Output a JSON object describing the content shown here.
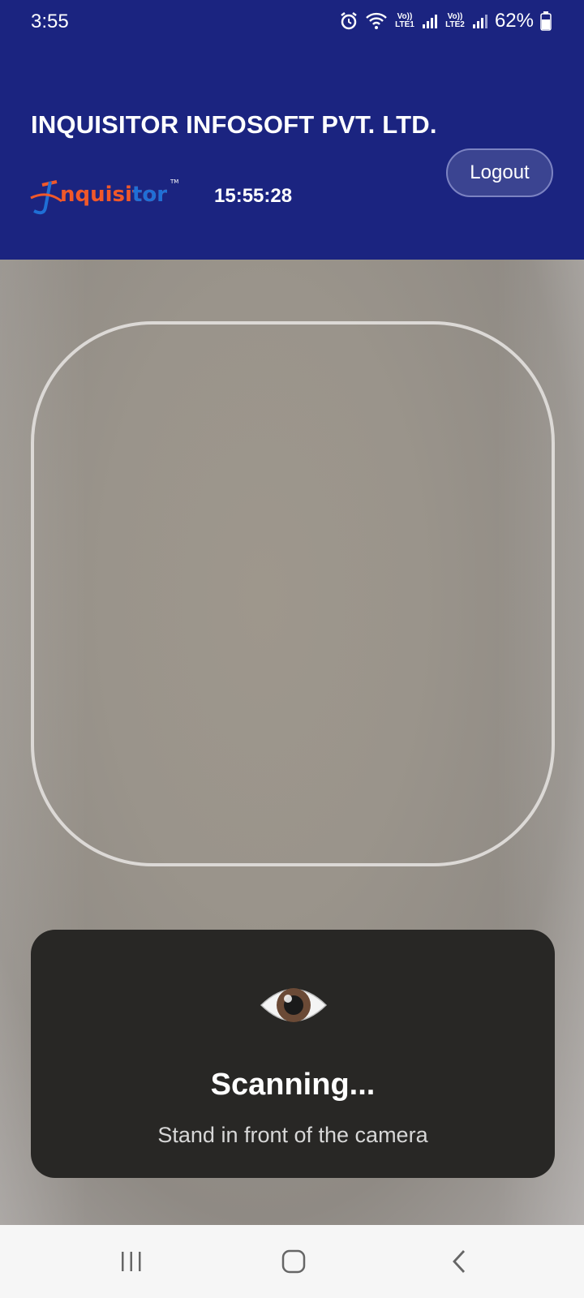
{
  "status_bar": {
    "time": "3:55",
    "battery": "62%",
    "sim1": "Vo)) LTE1",
    "sim2": "Vo)) LTE2",
    "icons": [
      "alarm-icon",
      "wifi-icon",
      "signal-icon",
      "battery-icon"
    ]
  },
  "header": {
    "company": "INQUISITOR INFOSOFT PVT. LTD.",
    "logo_text": "Inquisitor",
    "clock": "15:55:28",
    "logout_label": "Logout"
  },
  "scanner": {
    "status_icon": "eye-icon",
    "title": "Scanning...",
    "subtitle": "Stand in front of the camera"
  },
  "nav_bar": {
    "items": [
      "recent-apps-icon",
      "home-icon",
      "back-icon"
    ]
  },
  "colors": {
    "header_bg": "#1b2480",
    "card_bg": "#282725",
    "logo_blue": "#1f6fd6",
    "logo_orange": "#f0582a"
  }
}
